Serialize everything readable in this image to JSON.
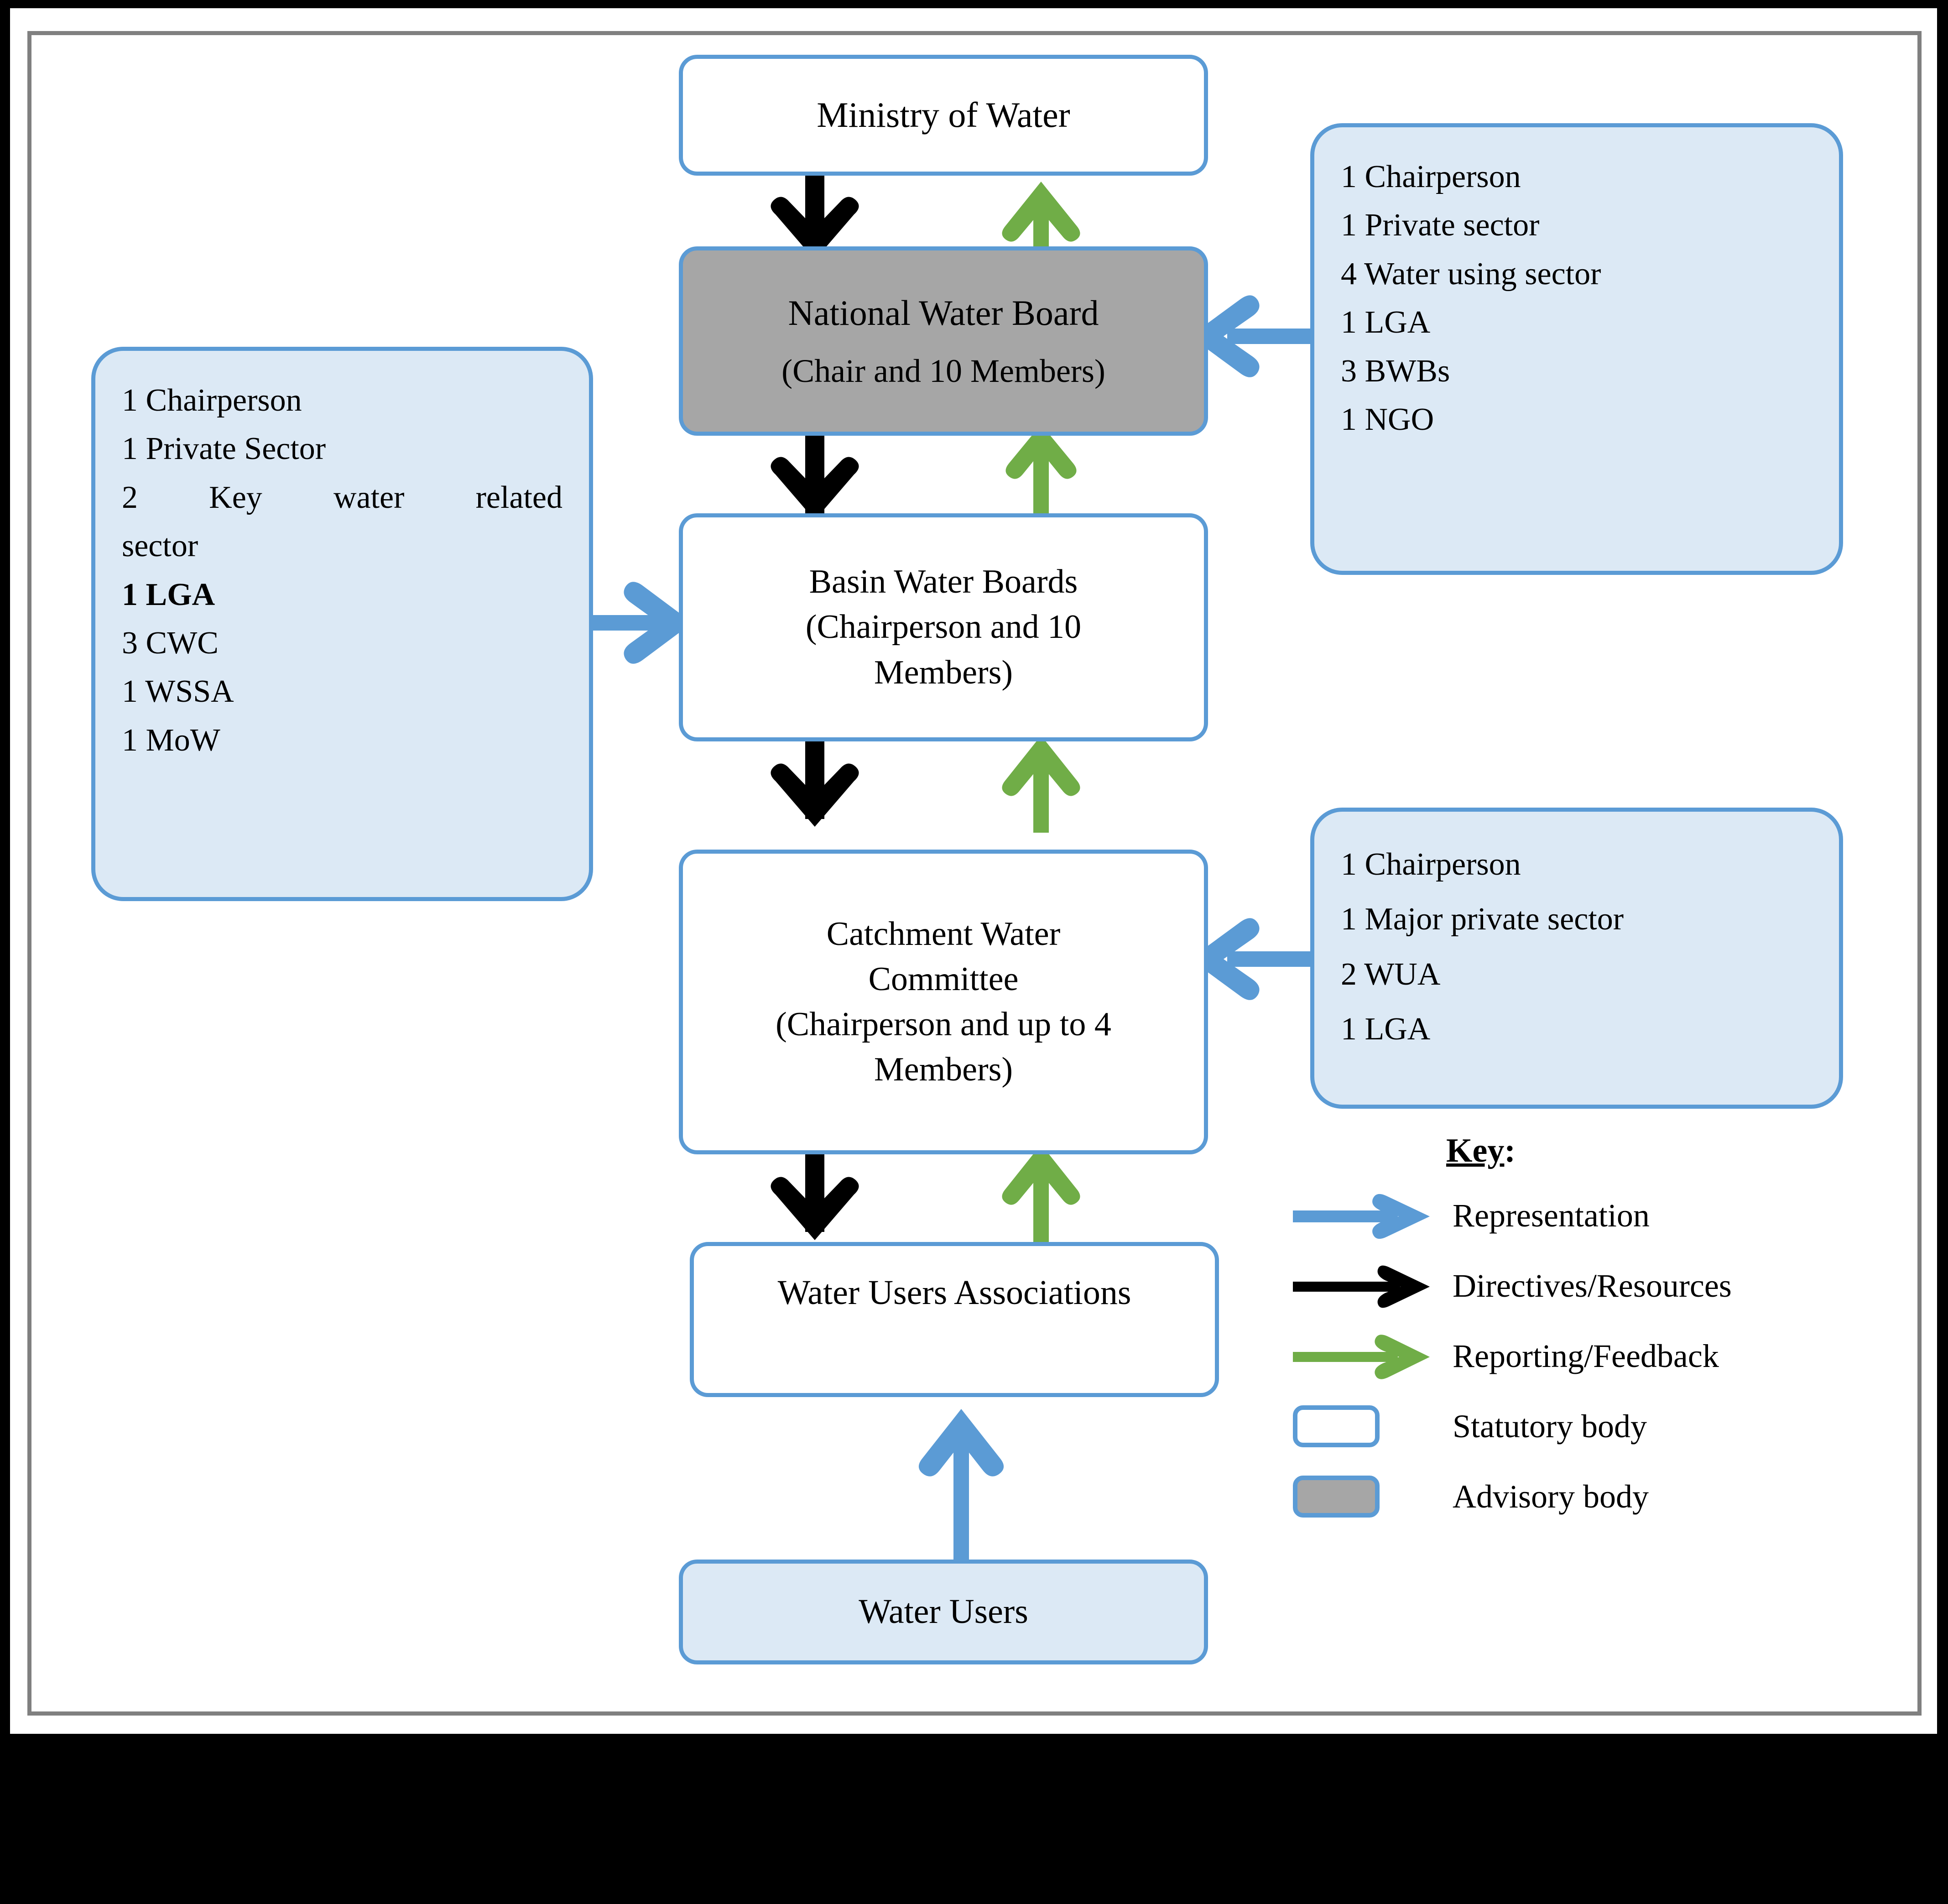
{
  "colors": {
    "border_blue": "#5B9BD5",
    "arrow_blue": "#5B9BD5",
    "arrow_black": "#000000",
    "arrow_green": "#70AD47",
    "advisory_gray": "#A6A6A6",
    "light_blue_fill": "#DCE9F5",
    "frame_gray": "#808080"
  },
  "nodes": {
    "ministry": {
      "label": "Ministry of Water"
    },
    "national_water_board": {
      "line1": "National Water Board",
      "line2": "(Chair and 10 Members)"
    },
    "basin_water_boards": {
      "line1": "Basin Water Boards",
      "line2": "(Chairperson and 10",
      "line3": "Members)"
    },
    "catchment_water_committee": {
      "line1": "Catchment Water",
      "line2": "Committee",
      "line3": "(Chairperson and up to 4",
      "line4": "Members)"
    },
    "water_users_associations": {
      "label": "Water Users Associations"
    },
    "water_users": {
      "label": "Water Users"
    }
  },
  "callouts": {
    "national_board_composition": {
      "lines": [
        "1 Chairperson",
        "1 Private sector",
        "4 Water using sector",
        "1 LGA",
        "3 BWBs",
        "1 NGO"
      ]
    },
    "basin_board_composition": {
      "lines": [
        "1 Chairperson",
        "1 Private Sector",
        "2 Key water related",
        "sector",
        "1 LGA",
        "3 CWC",
        "1 WSSA",
        "1 MoW"
      ],
      "bold_line_index": 4,
      "justified_line_index": 2
    },
    "catchment_committee_composition": {
      "lines": [
        "1 Chairperson",
        "1 Major private sector",
        "2 WUA",
        "1 LGA"
      ]
    }
  },
  "legend": {
    "title": "Key",
    "title_suffix": ":",
    "rows": [
      {
        "symbol": "blue-arrow-icon",
        "label": "Representation"
      },
      {
        "symbol": "black-arrow-icon",
        "label": "Directives/Resources"
      },
      {
        "symbol": "green-arrow-icon",
        "label": "Reporting/Feedback"
      },
      {
        "symbol": "white-box-icon",
        "label": "Statutory body"
      },
      {
        "symbol": "gray-box-icon",
        "label": "Advisory body"
      }
    ]
  }
}
